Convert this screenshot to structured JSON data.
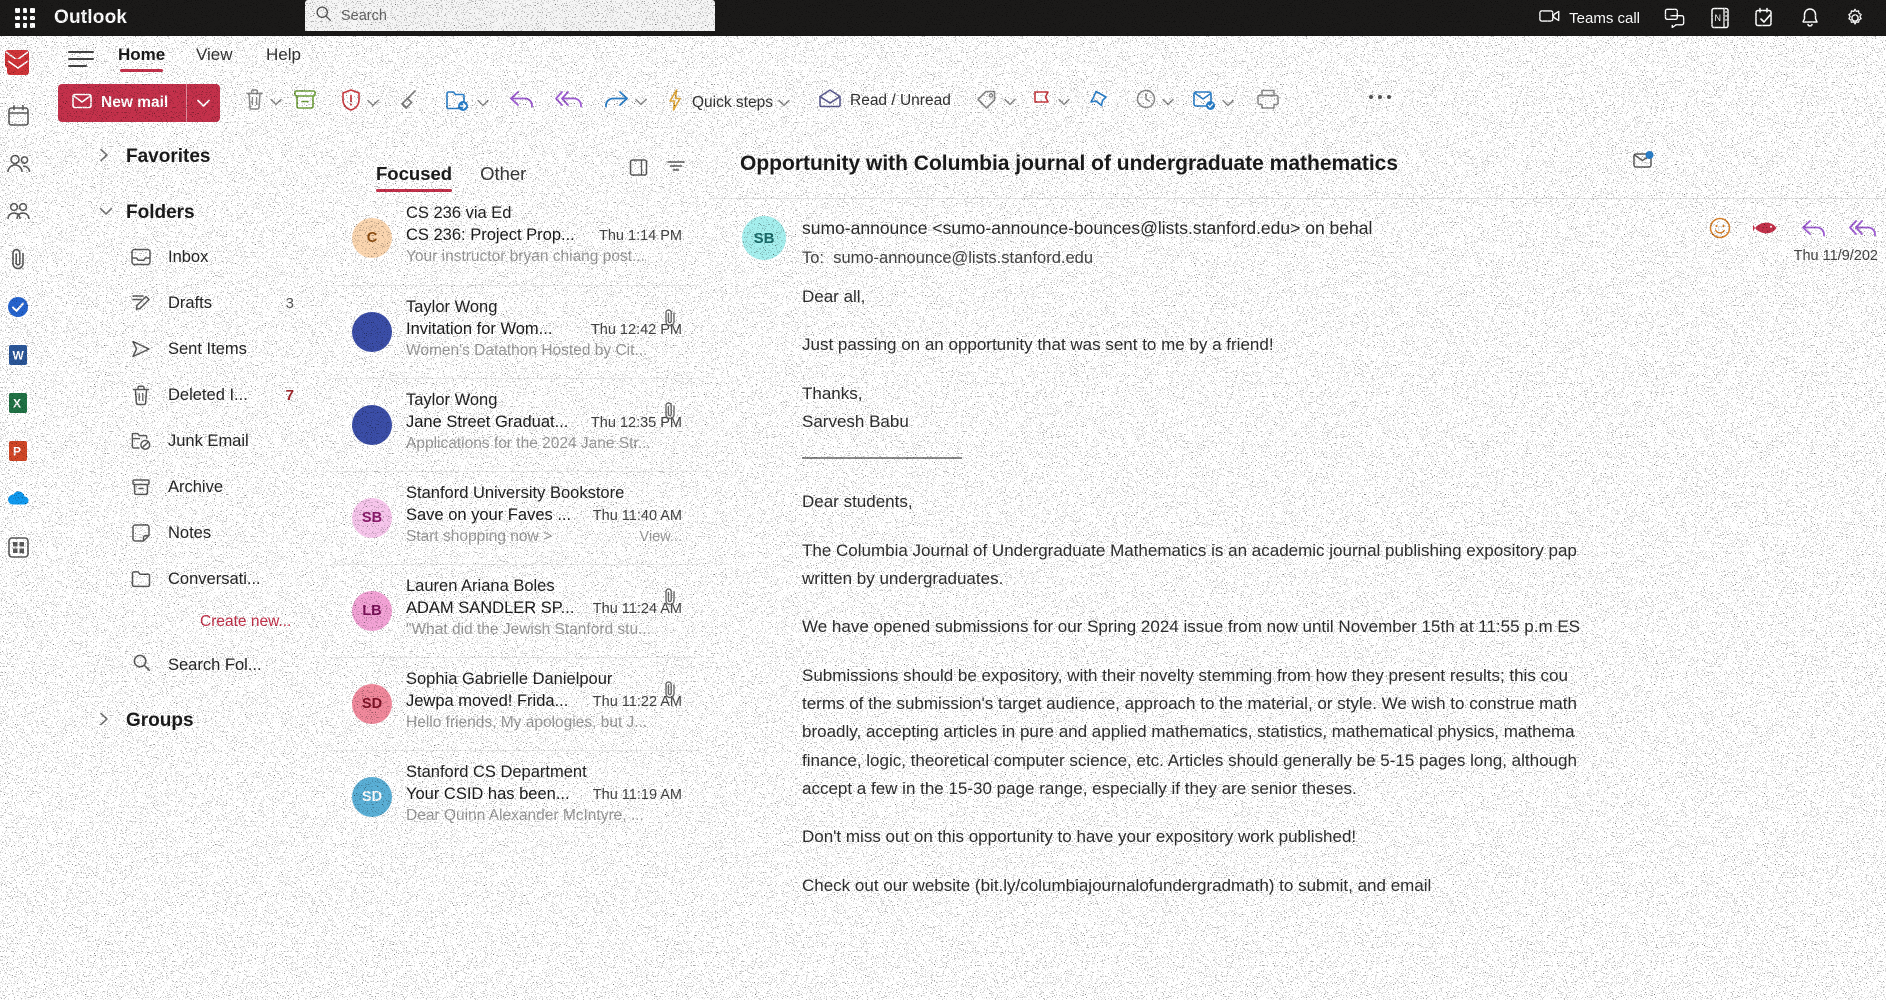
{
  "topbar": {
    "brand": "Outlook",
    "waffle_icon": "app-launcher-icon",
    "search": {
      "placeholder": "Search",
      "value": "",
      "icon": "search-icon"
    },
    "teams_call_label": "Teams call",
    "icons": [
      "video-camera-icon",
      "chat-icon",
      "onenote-icon",
      "to-do-icon",
      "bell-icon",
      "gear-icon"
    ]
  },
  "ribbon": {
    "hamburger_icon": "hamburger-icon",
    "mail_logo_icon": "outlook-mail-logo-icon",
    "tabs": [
      {
        "label": "Home",
        "active": true
      },
      {
        "label": "View",
        "active": false
      },
      {
        "label": "Help",
        "active": false
      }
    ]
  },
  "toolbar": {
    "new_mail_label": "New mail",
    "new_mail_icon": "envelope-icon",
    "new_mail_chevron": "chevron-down-icon",
    "items": [
      {
        "name": "delete-button",
        "icon": "trash-icon",
        "label": "",
        "chevron": true
      },
      {
        "name": "archive-button",
        "icon": "archive-icon",
        "label": "",
        "chevron": false
      },
      {
        "name": "report-button",
        "icon": "shield-alert-icon",
        "label": "",
        "chevron": true
      },
      {
        "name": "sweep-button",
        "icon": "broom-icon",
        "label": "",
        "chevron": false
      },
      {
        "name": "move-to-button",
        "icon": "move-folder-icon",
        "label": "",
        "chevron": true
      },
      {
        "name": "reply-button",
        "icon": "reply-arrow-icon",
        "label": "",
        "chevron": false
      },
      {
        "name": "reply-all-button",
        "icon": "reply-all-arrow-icon",
        "label": "",
        "chevron": false
      },
      {
        "name": "forward-button",
        "icon": "forward-arrow-icon",
        "label": "",
        "chevron": true
      },
      {
        "name": "quick-steps-button",
        "icon": "lightning-icon",
        "label": "Quick steps",
        "chevron": true
      },
      {
        "name": "read-unread-button",
        "icon": "envelope-open-icon",
        "label": "Read / Unread",
        "chevron": false
      },
      {
        "name": "categorize-button",
        "icon": "tag-icon",
        "label": "",
        "chevron": true
      },
      {
        "name": "flag-button",
        "icon": "flag-icon",
        "label": "",
        "chevron": true
      },
      {
        "name": "pin-button",
        "icon": "pin-icon",
        "label": "",
        "chevron": false
      },
      {
        "name": "snooze-button",
        "icon": "clock-icon",
        "label": "",
        "chevron": true
      },
      {
        "name": "rules-button",
        "icon": "rules-icon",
        "label": "",
        "chevron": true
      },
      {
        "name": "print-button",
        "icon": "printer-icon",
        "label": "",
        "chevron": false
      },
      {
        "name": "more-options-button",
        "icon": "ellipsis-icon",
        "label": "",
        "chevron": false
      }
    ]
  },
  "rail": {
    "items": [
      {
        "name": "rail-mail",
        "icon": "mail-icon"
      },
      {
        "name": "rail-calendar",
        "icon": "calendar-icon"
      },
      {
        "name": "rail-people",
        "icon": "people-icon"
      },
      {
        "name": "rail-groups",
        "icon": "group-icon"
      },
      {
        "name": "rail-files",
        "icon": "paperclip-icon"
      },
      {
        "name": "rail-todo",
        "icon": "to-do-check-icon"
      },
      {
        "name": "rail-word",
        "icon": "word-icon"
      },
      {
        "name": "rail-excel",
        "icon": "excel-icon"
      },
      {
        "name": "rail-powerpoint",
        "icon": "powerpoint-icon"
      },
      {
        "name": "rail-onedrive",
        "icon": "onedrive-icon"
      },
      {
        "name": "rail-apps",
        "icon": "apps-icon"
      }
    ]
  },
  "sidebar": {
    "favorites_label": "Favorites",
    "favorites_caret": "chevron-right-icon",
    "folders_label": "Folders",
    "folders_caret": "chevron-down-icon",
    "groups_label": "Groups",
    "groups_caret": "chevron-right-icon",
    "create_new_label": "Create new...",
    "search_folders_label": "Search Fol...",
    "search_folders_icon": "search-icon",
    "folders": [
      {
        "label": "Inbox",
        "count": "",
        "icon": "inbox-icon",
        "red": false
      },
      {
        "label": "Drafts",
        "count": "3",
        "icon": "drafts-icon",
        "red": false
      },
      {
        "label": "Sent Items",
        "count": "",
        "icon": "send-icon",
        "red": false
      },
      {
        "label": "Deleted I...",
        "count": "7",
        "icon": "trash-icon",
        "red": true
      },
      {
        "label": "Junk Email",
        "count": "",
        "icon": "junk-icon",
        "red": false
      },
      {
        "label": "Archive",
        "count": "",
        "icon": "archive-icon",
        "red": false
      },
      {
        "label": "Notes",
        "count": "",
        "icon": "notes-icon",
        "red": false
      },
      {
        "label": "Conversati...",
        "count": "",
        "icon": "folder-icon",
        "red": false
      }
    ]
  },
  "messagelist": {
    "pivots": [
      {
        "label": "Focused",
        "active": true
      },
      {
        "label": "Other",
        "active": false
      }
    ],
    "view_toggle_icon": "reading-pane-icon",
    "filter_icon": "filter-icon",
    "messages": [
      {
        "from": "CS 236 via Ed",
        "subject": "CS 236: Project Prop...",
        "time": "Thu 1:14 PM",
        "preview": "Your instructor bryan chiang post...",
        "extra": "",
        "initials": "C",
        "avatar_bg": "#fbd6b0",
        "avatar_fg": "#8a4b10",
        "attachment": false
      },
      {
        "from": "Taylor Wong",
        "subject": "Invitation for Wom...",
        "time": "Thu 12:42 PM",
        "preview": "Women's Datathon Hosted by Cit...",
        "extra": "",
        "initials": "",
        "avatar_bg": "#3b4ea8",
        "avatar_fg": "#ffffff",
        "attachment": true
      },
      {
        "from": "Taylor Wong",
        "subject": "Jane Street Graduat...",
        "time": "Thu 12:35 PM",
        "preview": "Applications for the 2024 Jane Str...",
        "extra": "",
        "initials": "",
        "avatar_bg": "#3b4ea8",
        "avatar_fg": "#ffffff",
        "attachment": true
      },
      {
        "from": "Stanford University Bookstore",
        "subject": "Save on your Faves ...",
        "time": "Thu 11:40 AM",
        "preview": "Start shopping now >",
        "extra": "View...",
        "initials": "SB",
        "avatar_bg": "#f7c6ec",
        "avatar_fg": "#8a1a6b",
        "attachment": false
      },
      {
        "from": "Lauren Ariana Boles",
        "subject": "ADAM SANDLER SP...",
        "time": "Thu 11:24 AM",
        "preview": "\"What did the Jewish Stanford stu...",
        "extra": "",
        "initials": "LB",
        "avatar_bg": "#f3a3d6",
        "avatar_fg": "#7a1258",
        "attachment": true
      },
      {
        "from": "Sophia Gabrielle Danielpour",
        "subject": "Jewpa moved! Frida...",
        "time": "Thu 11:22 AM",
        "preview": "Hello friends, My apologies, but J...",
        "extra": "",
        "initials": "SD",
        "avatar_bg": "#f1899c",
        "avatar_fg": "#7d1226",
        "attachment": true
      },
      {
        "from": "Stanford CS Department",
        "subject": "Your CSID has been...",
        "time": "Thu 11:19 AM",
        "preview": "Dear Quinn Alexander McIntyre, ...",
        "extra": "",
        "initials": "SD",
        "avatar_bg": "#5aafd6",
        "avatar_fg": "#ffffff",
        "attachment": false
      }
    ]
  },
  "readingpane": {
    "subject": "Opportunity with Columbia journal of undergraduate mathematics",
    "flag_icon": "mark-unread-icon",
    "sender_initials": "SB",
    "from": "sumo-announce <sumo-announce-bounces@lists.stanford.edu> on behal",
    "to_label": "To:",
    "to_value": "sumo-announce@lists.stanford.edu",
    "date": "Thu 11/9/202",
    "actions": [
      {
        "name": "react-emoji-button",
        "icon": "smiley-icon"
      },
      {
        "name": "translate-button",
        "icon": "fish-icon"
      },
      {
        "name": "reply-button",
        "icon": "reply-arrow-icon"
      },
      {
        "name": "reply-all-button",
        "icon": "reply-all-arrow-icon"
      }
    ],
    "body": [
      "Dear all,",
      "Just passing on an opportunity that was sent to me by a friend!",
      "Thanks,",
      "Sarvesh Babu",
      "Dear students,",
      "The Columbia Journal of Undergraduate Mathematics is an academic journal publishing expository pap",
      "written by undergraduates.",
      "We have opened submissions for our Spring 2024 issue from now until November 15th at 11:55 p.m ES",
      "Submissions should be expository, with their novelty stemming from how they present results; this cou",
      "terms of the submission's target audience, approach to the material, or style. We wish to construe math",
      "broadly, accepting articles in pure and applied mathematics, statistics, mathematical physics, mathema",
      "finance, logic, theoretical computer science, etc. Articles should generally be 5-15 pages long, although",
      "accept a few in the 15-30 page range, especially if they are senior theses.",
      "Don't miss out on this opportunity to have your expository work published!",
      "Check out our website (bit.ly/columbiajournalofundergradmath) to submit, and email"
    ]
  },
  "colors": {
    "accent_red": "#c4314b",
    "topbar_bg": "#1b1a19",
    "unread_red": "#a4262c"
  }
}
